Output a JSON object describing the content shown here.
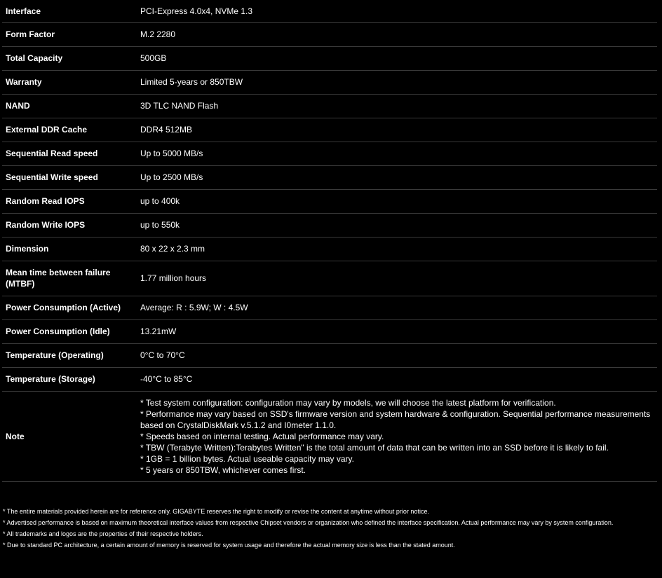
{
  "specs": [
    {
      "label": "Interface",
      "value": "PCI-Express 4.0x4, NVMe 1.3"
    },
    {
      "label": "Form Factor",
      "value": "M.2 2280"
    },
    {
      "label": "Total Capacity",
      "value": "500GB"
    },
    {
      "label": "Warranty",
      "value": "Limited 5-years or 850TBW"
    },
    {
      "label": "NAND",
      "value": "3D TLC NAND Flash"
    },
    {
      "label": "External DDR Cache",
      "value": "DDR4 512MB"
    },
    {
      "label": "Sequential Read speed",
      "value": "Up to 5000 MB/s"
    },
    {
      "label": "Sequential Write speed",
      "value": "Up to 2500 MB/s"
    },
    {
      "label": "Random Read IOPS",
      "value": "up to 400k"
    },
    {
      "label": "Random Write IOPS",
      "value": "up to 550k"
    },
    {
      "label": "Dimension",
      "value": "80 x 22 x 2.3 mm"
    },
    {
      "label": "Mean time between failure (MTBF)",
      "value": "1.77 million hours"
    },
    {
      "label": "Power Consumption (Active)",
      "value": "Average: R : 5.9W; W : 4.5W"
    },
    {
      "label": "Power Consumption (Idle)",
      "value": "13.21mW"
    },
    {
      "label": "Temperature (Operating)",
      "value": "0°C to 70°C"
    },
    {
      "label": "Temperature (Storage)",
      "value": "-40°C to 85°C"
    }
  ],
  "note": {
    "label": "Note",
    "lines": [
      "* Test system configuration: configuration may vary by models, we will choose the latest platform for verification.",
      "* Performance may vary based on SSD's firmware version and system hardware & configuration. Sequential performance measurements based on CrystalDiskMark v.5.1.2 and I0meter 1.1.0.",
      "* Speeds based on internal testing. Actual performance may vary.",
      "* TBW (Terabyte Written):Terabytes Written\" is the total amount of data that can be written into an SSD before it is likely to fail.",
      "* 1GB = 1 billion bytes. Actual useable capacity may vary.",
      "* 5 years or 850TBW, whichever comes first."
    ]
  },
  "footer": [
    "* The entire materials provided herein are for reference only. GIGABYTE reserves the right to modify or revise the content at anytime without prior notice.",
    "* Advertised performance is based on maximum theoretical interface values from respective Chipset vendors or organization who defined the interface specification. Actual performance may vary by system configuration.",
    "* All trademarks and logos are the properties of their respective holders.",
    "* Due to standard PC architecture, a certain amount of memory is reserved for system usage and therefore the actual memory size is less than the stated amount."
  ]
}
